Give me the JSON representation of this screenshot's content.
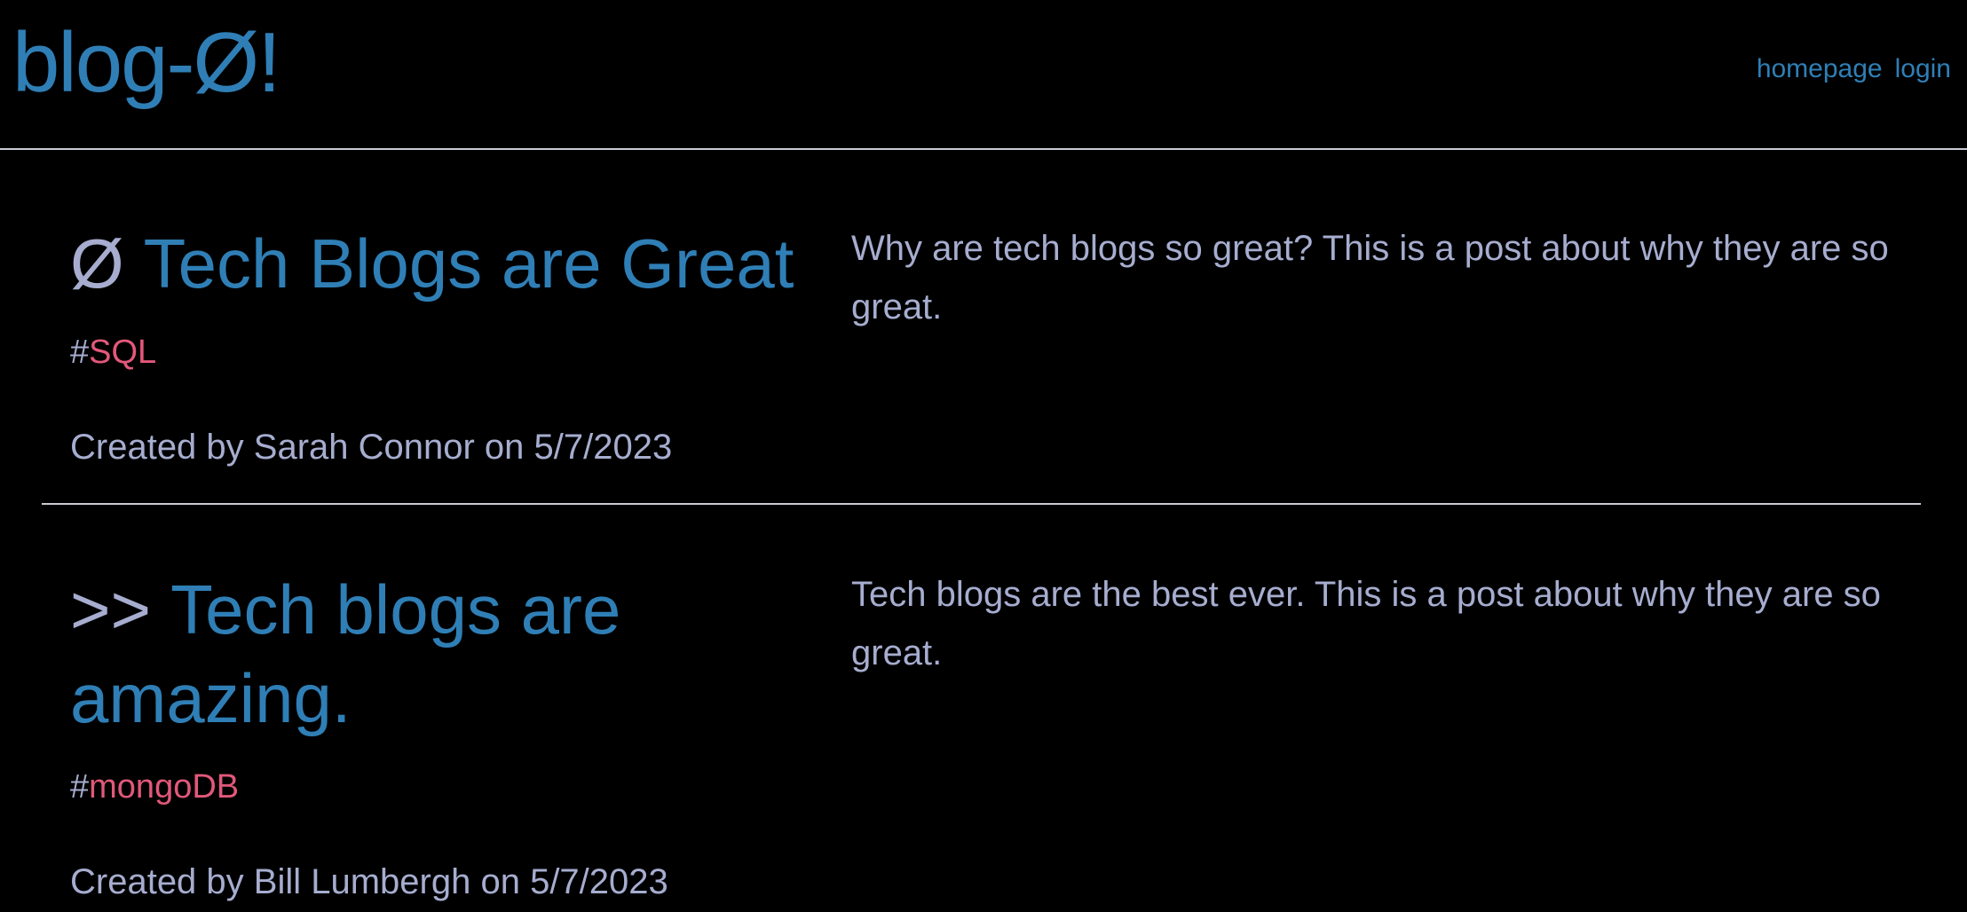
{
  "site": {
    "logo": "blog-Ø!",
    "nav": [
      {
        "label": "homepage"
      },
      {
        "label": "login"
      }
    ]
  },
  "posts": [
    {
      "marker": "Ø",
      "title": "Tech Blogs are Great",
      "hash": "#",
      "tag": "SQL",
      "meta": "Created by Sarah Connor on 5/7/2023",
      "body": "Why are tech blogs so great? This is a post about why they are so great."
    },
    {
      "marker": ">>",
      "title": "Tech blogs are amazing.",
      "hash": "#",
      "tag": "mongoDB",
      "meta": "Created by Bill Lumbergh on 5/7/2023",
      "body": "Tech blogs are the best ever. This is a post about why they are so great."
    }
  ],
  "colors": {
    "background": "#000000",
    "accent": "#2f7fb6",
    "text": "#a6adcf",
    "tag": "#e2587a",
    "divider": "#c9ccd3"
  }
}
